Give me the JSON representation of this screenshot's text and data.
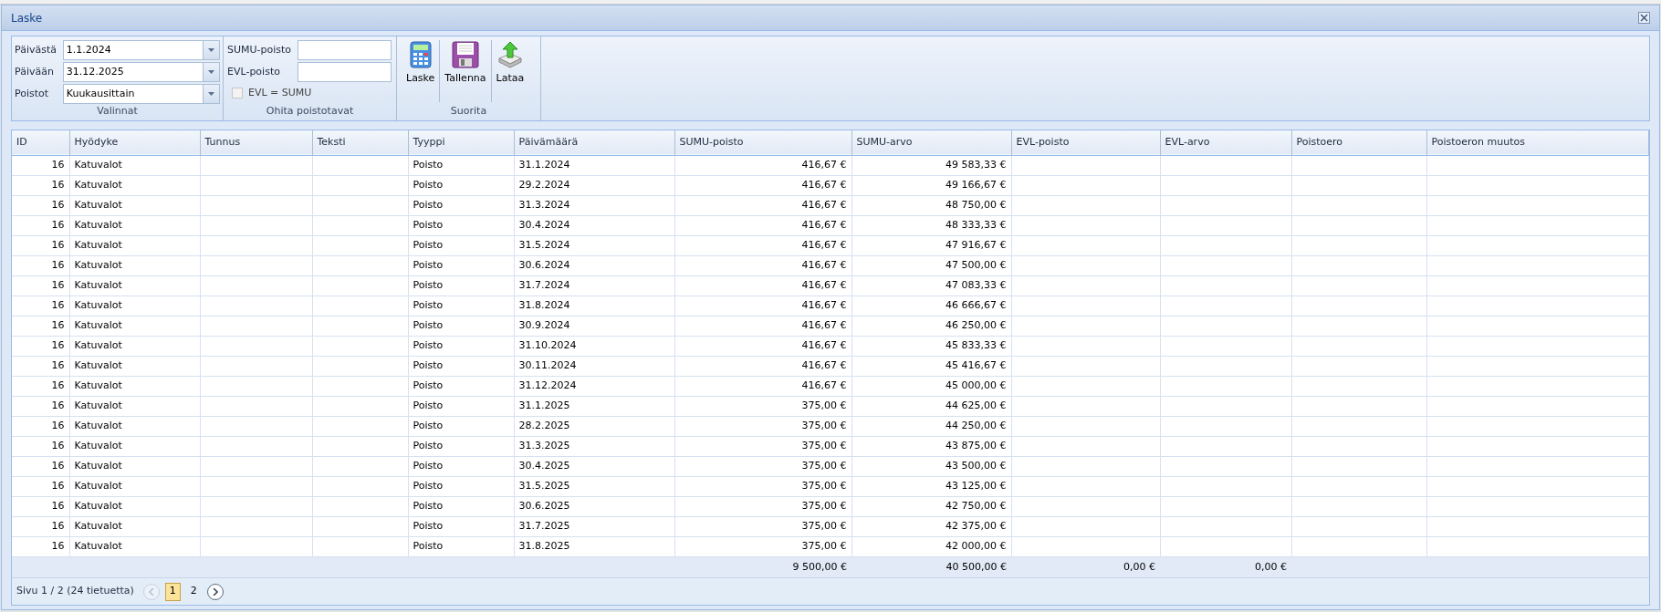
{
  "window": {
    "title": "Laske"
  },
  "toolbar": {
    "groups": [
      {
        "kind": "selections",
        "label": "Valinnat",
        "fields": [
          {
            "label": "Päivästä",
            "value": "1.1.2024"
          },
          {
            "label": "Päivään",
            "value": "31.12.2025"
          },
          {
            "label": "Poistot",
            "value": "Kuukausittain"
          }
        ]
      },
      {
        "kind": "overrides",
        "label": "Ohita poistotavat",
        "fields": [
          {
            "label": "SUMU-poisto"
          },
          {
            "label": "EVL-poisto"
          }
        ],
        "checkbox": {
          "label": "EVL = SUMU",
          "checked": false
        }
      },
      {
        "kind": "actions",
        "label": "Suorita",
        "buttons": [
          {
            "label": "Laske"
          },
          {
            "label": "Tallenna"
          },
          {
            "label": "Lataa"
          }
        ]
      }
    ]
  },
  "table": {
    "columns": [
      {
        "label": "ID"
      },
      {
        "label": "Hyödyke"
      },
      {
        "label": "Tunnus"
      },
      {
        "label": "Teksti"
      },
      {
        "label": "Tyyppi"
      },
      {
        "label": "Päivämäärä"
      },
      {
        "label": "SUMU-poisto"
      },
      {
        "label": "SUMU-arvo"
      },
      {
        "label": "EVL-poisto"
      },
      {
        "label": "EVL-arvo"
      },
      {
        "label": "Poistoero"
      },
      {
        "label": "Poistoeron muutos"
      }
    ],
    "rows": [
      {
        "id": "16",
        "hyodyke": "Katuvalot",
        "tyyppi": "Poisto",
        "paivamaara": "31.1.2024",
        "sumu_poisto": "416,67 €",
        "sumu_arvo": "49 583,33 €"
      },
      {
        "id": "16",
        "hyodyke": "Katuvalot",
        "tyyppi": "Poisto",
        "paivamaara": "29.2.2024",
        "sumu_poisto": "416,67 €",
        "sumu_arvo": "49 166,67 €"
      },
      {
        "id": "16",
        "hyodyke": "Katuvalot",
        "tyyppi": "Poisto",
        "paivamaara": "31.3.2024",
        "sumu_poisto": "416,67 €",
        "sumu_arvo": "48 750,00 €"
      },
      {
        "id": "16",
        "hyodyke": "Katuvalot",
        "tyyppi": "Poisto",
        "paivamaara": "30.4.2024",
        "sumu_poisto": "416,67 €",
        "sumu_arvo": "48 333,33 €"
      },
      {
        "id": "16",
        "hyodyke": "Katuvalot",
        "tyyppi": "Poisto",
        "paivamaara": "31.5.2024",
        "sumu_poisto": "416,67 €",
        "sumu_arvo": "47 916,67 €"
      },
      {
        "id": "16",
        "hyodyke": "Katuvalot",
        "tyyppi": "Poisto",
        "paivamaara": "30.6.2024",
        "sumu_poisto": "416,67 €",
        "sumu_arvo": "47 500,00 €"
      },
      {
        "id": "16",
        "hyodyke": "Katuvalot",
        "tyyppi": "Poisto",
        "paivamaara": "31.7.2024",
        "sumu_poisto": "416,67 €",
        "sumu_arvo": "47 083,33 €"
      },
      {
        "id": "16",
        "hyodyke": "Katuvalot",
        "tyyppi": "Poisto",
        "paivamaara": "31.8.2024",
        "sumu_poisto": "416,67 €",
        "sumu_arvo": "46 666,67 €"
      },
      {
        "id": "16",
        "hyodyke": "Katuvalot",
        "tyyppi": "Poisto",
        "paivamaara": "30.9.2024",
        "sumu_poisto": "416,67 €",
        "sumu_arvo": "46 250,00 €"
      },
      {
        "id": "16",
        "hyodyke": "Katuvalot",
        "tyyppi": "Poisto",
        "paivamaara": "31.10.2024",
        "sumu_poisto": "416,67 €",
        "sumu_arvo": "45 833,33 €"
      },
      {
        "id": "16",
        "hyodyke": "Katuvalot",
        "tyyppi": "Poisto",
        "paivamaara": "30.11.2024",
        "sumu_poisto": "416,67 €",
        "sumu_arvo": "45 416,67 €"
      },
      {
        "id": "16",
        "hyodyke": "Katuvalot",
        "tyyppi": "Poisto",
        "paivamaara": "31.12.2024",
        "sumu_poisto": "416,67 €",
        "sumu_arvo": "45 000,00 €"
      },
      {
        "id": "16",
        "hyodyke": "Katuvalot",
        "tyyppi": "Poisto",
        "paivamaara": "31.1.2025",
        "sumu_poisto": "375,00 €",
        "sumu_arvo": "44 625,00 €"
      },
      {
        "id": "16",
        "hyodyke": "Katuvalot",
        "tyyppi": "Poisto",
        "paivamaara": "28.2.2025",
        "sumu_poisto": "375,00 €",
        "sumu_arvo": "44 250,00 €"
      },
      {
        "id": "16",
        "hyodyke": "Katuvalot",
        "tyyppi": "Poisto",
        "paivamaara": "31.3.2025",
        "sumu_poisto": "375,00 €",
        "sumu_arvo": "43 875,00 €"
      },
      {
        "id": "16",
        "hyodyke": "Katuvalot",
        "tyyppi": "Poisto",
        "paivamaara": "30.4.2025",
        "sumu_poisto": "375,00 €",
        "sumu_arvo": "43 500,00 €"
      },
      {
        "id": "16",
        "hyodyke": "Katuvalot",
        "tyyppi": "Poisto",
        "paivamaara": "31.5.2025",
        "sumu_poisto": "375,00 €",
        "sumu_arvo": "43 125,00 €"
      },
      {
        "id": "16",
        "hyodyke": "Katuvalot",
        "tyyppi": "Poisto",
        "paivamaara": "30.6.2025",
        "sumu_poisto": "375,00 €",
        "sumu_arvo": "42 750,00 €"
      },
      {
        "id": "16",
        "hyodyke": "Katuvalot",
        "tyyppi": "Poisto",
        "paivamaara": "31.7.2025",
        "sumu_poisto": "375,00 €",
        "sumu_arvo": "42 375,00 €"
      },
      {
        "id": "16",
        "hyodyke": "Katuvalot",
        "tyyppi": "Poisto",
        "paivamaara": "31.8.2025",
        "sumu_poisto": "375,00 €",
        "sumu_arvo": "42 000,00 €"
      }
    ],
    "totals": {
      "sumu_poisto": "9 500,00 €",
      "sumu_arvo": "40 500,00 €",
      "evl_poisto": "0,00 €",
      "evl_arvo": "0,00 €"
    }
  },
  "pager": {
    "summary": "Sivu 1 / 2 (24 tietuetta)",
    "prev_disabled": true,
    "next_disabled": false,
    "pages": [
      {
        "label": "1",
        "selected": true
      },
      {
        "label": "2",
        "selected": false
      }
    ]
  }
}
